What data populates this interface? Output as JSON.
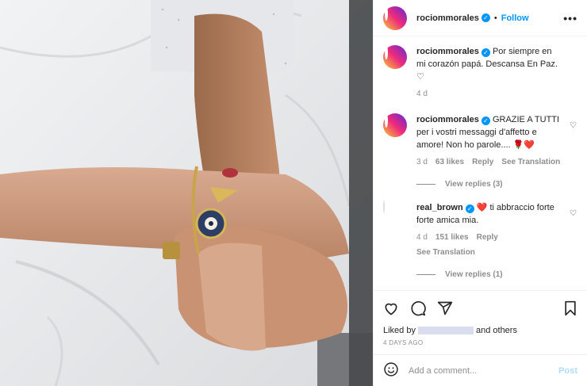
{
  "header": {
    "username": "rociommorales",
    "dot": "•",
    "follow_label": "Follow",
    "more_label": "•••"
  },
  "caption": {
    "username": "rociommorales",
    "text": "Por siempre en mi corazón papá. Descansa En Paz. ♡",
    "time": "4 d"
  },
  "comments": [
    {
      "username": "rociommorales",
      "text": "GRAZIE A TUTTI per i vostri messaggi d'affetto e amore! Non ho parole.... 🌹❤️",
      "time": "3 d",
      "likes": "63 likes",
      "reply": "Reply",
      "translate": "See Translation",
      "view_replies": "View replies (3)"
    },
    {
      "username": "real_brown",
      "text": "❤️ ti abbraccio forte forte amica mia.",
      "time": "4 d",
      "likes": "151 likes",
      "reply": "Reply",
      "translate": "See Translation",
      "view_replies": "View replies (1)"
    }
  ],
  "actions": {
    "icons": [
      "heart-icon",
      "comment-icon",
      "share-icon",
      "bookmark-icon"
    ],
    "liked_by_prefix": "Liked by",
    "liked_by_suffix": "and others",
    "date": "4 DAYS AGO"
  },
  "add_comment": {
    "placeholder": "Add a comment...",
    "post_label": "Post"
  },
  "colors": {
    "accent": "#0095f6",
    "post_disabled": "#b3dbff",
    "muted": "#8e8e8e"
  }
}
